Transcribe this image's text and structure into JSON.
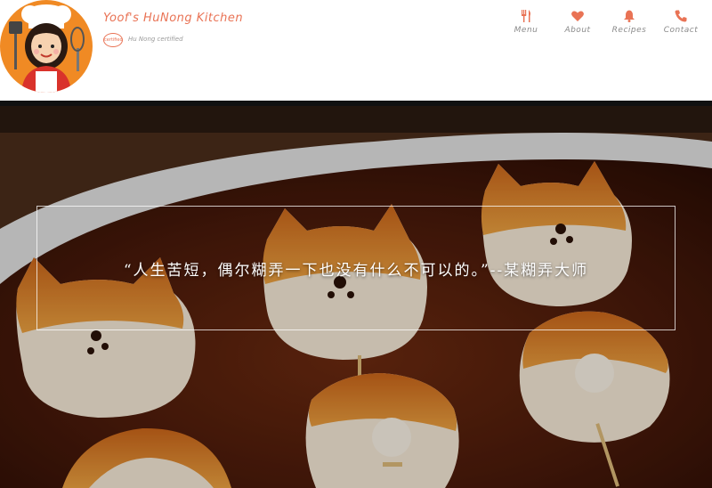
{
  "brand": {
    "title": "Yoof's HuNong Kitchen",
    "badge": "certified",
    "badge_text": "Hu Nong certified",
    "accent": "#e97355",
    "logo_bg": "#f08a24"
  },
  "nav": {
    "items": [
      {
        "label": "Menu",
        "icon": "utensils-icon"
      },
      {
        "label": "About",
        "icon": "heart-icon"
      },
      {
        "label": "Recipes",
        "icon": "bell-icon"
      },
      {
        "label": "Contact",
        "icon": "phone-icon"
      }
    ],
    "icon_color": "#e97355"
  },
  "hero": {
    "quote": "“人生苦短，偶尔糊弄一下也没有什么不可以的。”--某糊弄大师"
  }
}
